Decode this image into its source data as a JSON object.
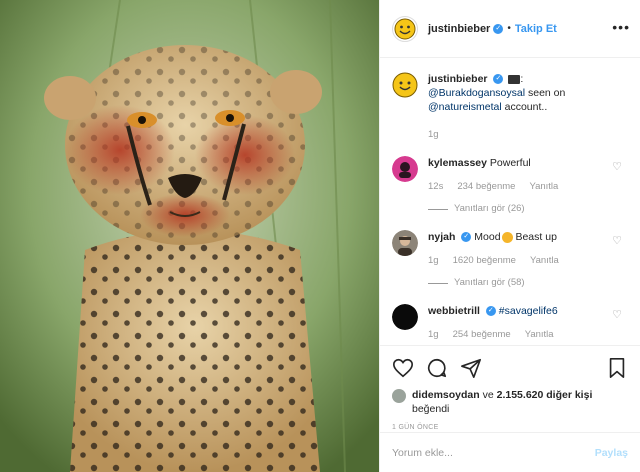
{
  "header": {
    "username": "justinbieber",
    "separator": "•",
    "follow_label": "Takip Et",
    "more_icon": "more-horizontal-icon"
  },
  "caption": {
    "username": "justinbieber",
    "emoji_icon": "camera-icon",
    "colon": ":",
    "mention1": "@Burakdogansoysal",
    "text1": " seen on ",
    "mention2": "@natureismetal",
    "text2": " account..",
    "time": "1g"
  },
  "comments": [
    {
      "username": "kylemassey",
      "text": "Powerful",
      "time": "12s",
      "likes": "234 beğenme",
      "reply": "Yanıtla",
      "view_replies": "Yanıtları gör (26)"
    },
    {
      "username": "nyjah",
      "text": "Mood",
      "emoji_icon": "angry-face-icon",
      "text_after": " Beast up",
      "time": "1g",
      "likes": "1620 beğenme",
      "reply": "Yanıtla",
      "view_replies": "Yanıtları gör (58)"
    },
    {
      "username": "webbietrill",
      "hashtag": "#savagelife6",
      "time": "1g",
      "likes": "254 beğenme",
      "reply": "Yanıtla"
    }
  ],
  "likes": {
    "user": "didemsoydan",
    "conj": " ve ",
    "count": "2.155.620 diğer kişi",
    "suffix": "beğendi"
  },
  "date": "1 GÜN ÖNCE",
  "comment_input": {
    "placeholder": "Yorum ekle...",
    "submit_label": "Paylaş"
  },
  "colors": {
    "accent": "#3897f0",
    "mention": "#003569",
    "muted": "#999999"
  }
}
